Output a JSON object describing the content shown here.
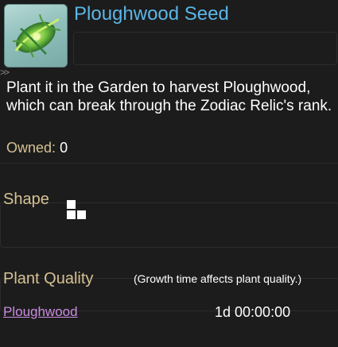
{
  "item": {
    "name": "Ploughwood Seed",
    "icon": "seed-pod-icon",
    "chevrons": ">>",
    "description": "Plant it in the Garden to harvest Ploughwood, which can break through the Zodiac Relic's rank.",
    "owned_label": "Owned:",
    "owned_value": "0"
  },
  "shape": {
    "label": "Shape",
    "cells": 3
  },
  "plant_quality": {
    "label": "Plant Quality",
    "note": "(Growth time affects plant quality.)",
    "rows": [
      {
        "name": "Ploughwood",
        "time": "1d 00:00:00"
      }
    ]
  },
  "colors": {
    "title": "#5ab6e6",
    "label_gold": "#d7c193",
    "link_purple": "#c98be0",
    "background": "#1c1c1c"
  }
}
